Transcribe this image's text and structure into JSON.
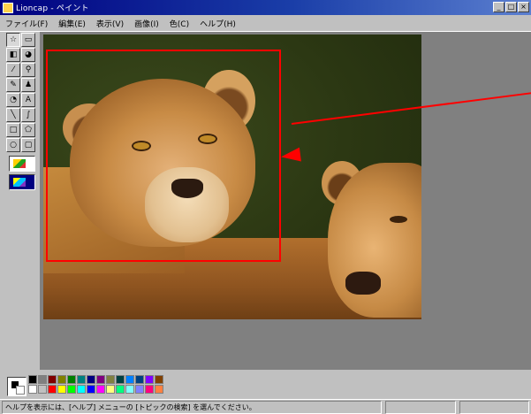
{
  "window": {
    "title": "Lioncap - ペイント"
  },
  "title_buttons": {
    "minimize": "_",
    "maximize": "□",
    "close": "×"
  },
  "menu": [
    "ファイル(F)",
    "編集(E)",
    "表示(V)",
    "画像(I)",
    "色(C)",
    "ヘルプ(H)"
  ],
  "tools": [
    {
      "icon": "free-select-icon",
      "glyph": "☆"
    },
    {
      "icon": "rect-select-icon",
      "glyph": "▭"
    },
    {
      "icon": "eraser-icon",
      "glyph": "◧"
    },
    {
      "icon": "fill-icon",
      "glyph": "◕"
    },
    {
      "icon": "color-picker-icon",
      "glyph": "⁄"
    },
    {
      "icon": "magnifier-icon",
      "glyph": "⚲"
    },
    {
      "icon": "pencil-icon",
      "glyph": "✎"
    },
    {
      "icon": "brush-icon",
      "glyph": "♟"
    },
    {
      "icon": "airbrush-icon",
      "glyph": "◔"
    },
    {
      "icon": "text-icon",
      "glyph": "A"
    },
    {
      "icon": "line-icon",
      "glyph": "╲"
    },
    {
      "icon": "curve-icon",
      "glyph": "∫"
    },
    {
      "icon": "rectangle-icon",
      "glyph": "□"
    },
    {
      "icon": "polygon-icon",
      "glyph": "⬠"
    },
    {
      "icon": "ellipse-icon",
      "glyph": "○"
    },
    {
      "icon": "rounded-rect-icon",
      "glyph": "▢"
    }
  ],
  "palette": [
    "#000000",
    "#808080",
    "#800000",
    "#808000",
    "#008000",
    "#008080",
    "#000080",
    "#800080",
    "#808040",
    "#004040",
    "#0080ff",
    "#004080",
    "#8000ff",
    "#804000",
    "#ffffff",
    "#c0c0c0",
    "#ff0000",
    "#ffff00",
    "#00ff00",
    "#00ffff",
    "#0000ff",
    "#ff00ff",
    "#ffff80",
    "#00ff80",
    "#80ffff",
    "#8080ff",
    "#ff0080",
    "#ff8040"
  ],
  "status": {
    "text": "ヘルプを表示には、[ヘルプ] メニューの [トピックの検索] を選んでください。"
  }
}
